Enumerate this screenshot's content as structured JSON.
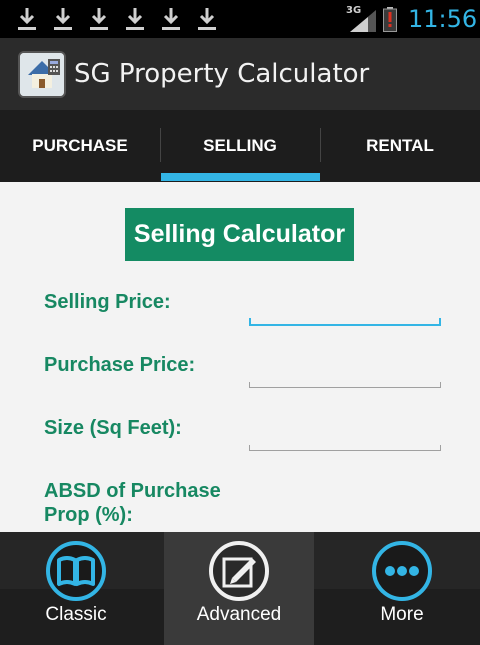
{
  "status_bar": {
    "network": "3G",
    "time": "11:56",
    "icons": [
      "download-icon",
      "download-icon",
      "download-icon",
      "download-icon",
      "download-icon",
      "download-icon",
      "signal-icon",
      "battery-alert-icon"
    ],
    "accent": "#33b5e5"
  },
  "app": {
    "title": "SG Property Calculator",
    "icon": "house-calculator-icon"
  },
  "tabs": [
    {
      "label": "PURCHASE",
      "selected": false
    },
    {
      "label": "SELLING",
      "selected": true
    },
    {
      "label": "RENTAL",
      "selected": false
    }
  ],
  "calculator": {
    "title": "Selling Calculator",
    "fields": [
      {
        "label": "Selling Price:",
        "value": ""
      },
      {
        "label": "Purchase Price:",
        "value": ""
      },
      {
        "label": "Size (Sq Feet):",
        "value": ""
      },
      {
        "label_line1": "ABSD of Purchase",
        "label_line2": "Prop (%):",
        "value": ""
      }
    ],
    "title_bg": "#148b63",
    "label_color": "#178862"
  },
  "bottom_nav": [
    {
      "label": "Classic",
      "icon": "book-icon",
      "selected": false
    },
    {
      "label": "Advanced",
      "icon": "edit-icon",
      "selected": true
    },
    {
      "label": "More",
      "icon": "more-icon",
      "selected": false
    }
  ]
}
